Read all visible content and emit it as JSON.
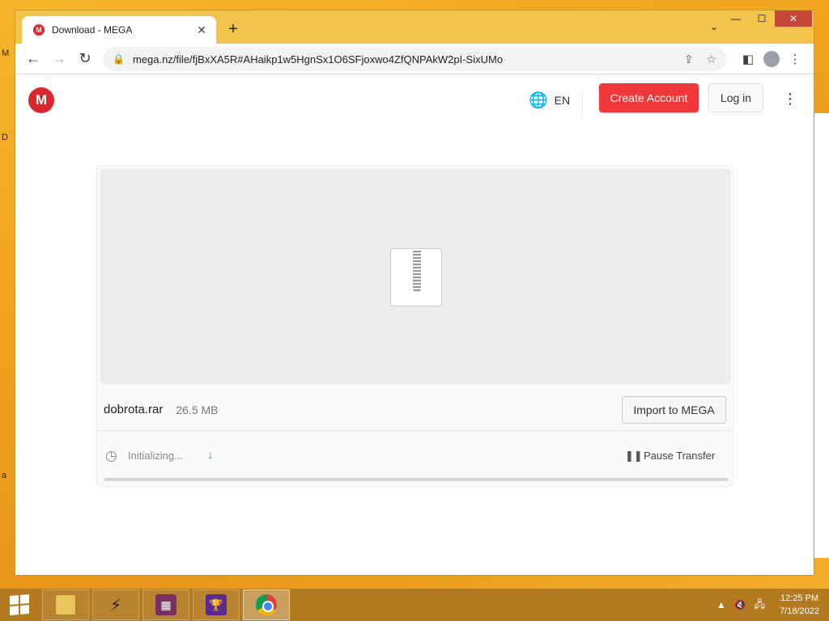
{
  "desktop": {
    "edge_letters": [
      "M",
      "D",
      "a"
    ]
  },
  "browser": {
    "tab": {
      "title": "Download - MEGA",
      "favicon": "M",
      "close": "✕"
    },
    "new_tab": "+",
    "tab_search": "⌄",
    "window_controls": {
      "minimize": "—",
      "maximize": "☐",
      "close": "✕"
    },
    "nav": {
      "back": "←",
      "forward": "→",
      "reload": "↻"
    },
    "omnibox": {
      "lock": "🔒",
      "url": "mega.nz/file/fjBxXA5R#AHaikp1w5HgnSx1O6SFjoxwo4ZfQNPAkW2pI-SixUMo",
      "share": "⇪",
      "bookmark": "☆"
    },
    "right_icons": {
      "side_panel": "◧",
      "menu": "⋮"
    }
  },
  "page": {
    "logo": "M",
    "language": {
      "icon": "🌐",
      "label": "EN"
    },
    "create_account": "Create Account",
    "login": "Log in",
    "more": "⋮",
    "file": {
      "name": "dobrota.rar",
      "size": "26.5 MB",
      "import_label": "Import to MEGA",
      "status": "Initializing...",
      "pause_label": "Pause Transfer",
      "pause_icon": "❚❚",
      "progress": 0
    }
  },
  "taskbar": {
    "apps": [
      "file-explorer",
      "winamp",
      "winrar",
      "trophy-app",
      "chrome"
    ],
    "tray": {
      "expand": "▲",
      "volume": "🔇",
      "network": "🖧"
    },
    "time": "12:25 PM",
    "date": "7/18/2022"
  },
  "colors": {
    "mega_red": "#d9272e",
    "create_btn": "#f0373a",
    "accent_green": "#1db87e"
  }
}
